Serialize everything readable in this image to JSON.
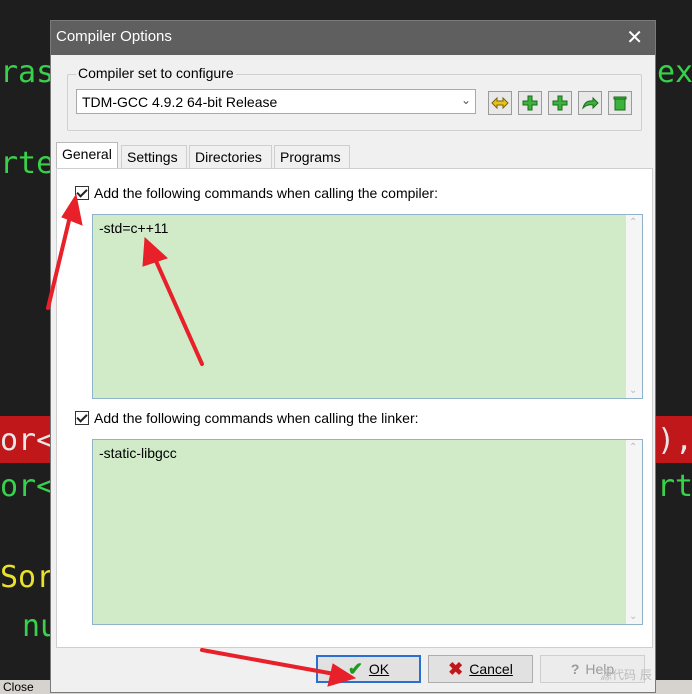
{
  "background_code": {
    "lines": [
      {
        "text": "ras",
        "x_hint": "left"
      },
      {
        "text": "ex",
        "x_hint": "right"
      },
      {
        "text": "rte",
        "x_hint": "left"
      },
      {
        "text": "or<",
        "x_hint": "left"
      },
      {
        "text": "),",
        "x_hint": "right"
      },
      {
        "text": "or<",
        "x_hint": "left"
      },
      {
        "text": "rt",
        "x_hint": "right"
      },
      {
        "text": "Sor",
        "x_hint": "left"
      },
      {
        "text": "nu",
        "x_hint": "left"
      }
    ],
    "close_label": "Close"
  },
  "dialog": {
    "title": "Compiler Options",
    "close_glyph": "✕",
    "compiler_set_label": "Compiler set to configure",
    "compiler_set_value": "TDM-GCC 4.9.2 64-bit Release",
    "tabs": [
      "General",
      "Settings",
      "Directories",
      "Programs"
    ],
    "active_tab": "General",
    "compiler_cmds_label": "Add the following commands when calling the compiler:",
    "compiler_cmds_value": "-std=c++11",
    "linker_cmds_label": "Add the following commands when calling the linker:",
    "linker_cmds_value": "-static-libgcc",
    "buttons": {
      "ok": "OK",
      "cancel": "Cancel",
      "help": "Help"
    }
  },
  "watermark": "源代码 辰",
  "colors": {
    "title_bar": "#5f5f5f",
    "textarea_bg": "#d1ebc9",
    "arrow": "#e8202a",
    "ok_border": "#2b6fd1"
  }
}
